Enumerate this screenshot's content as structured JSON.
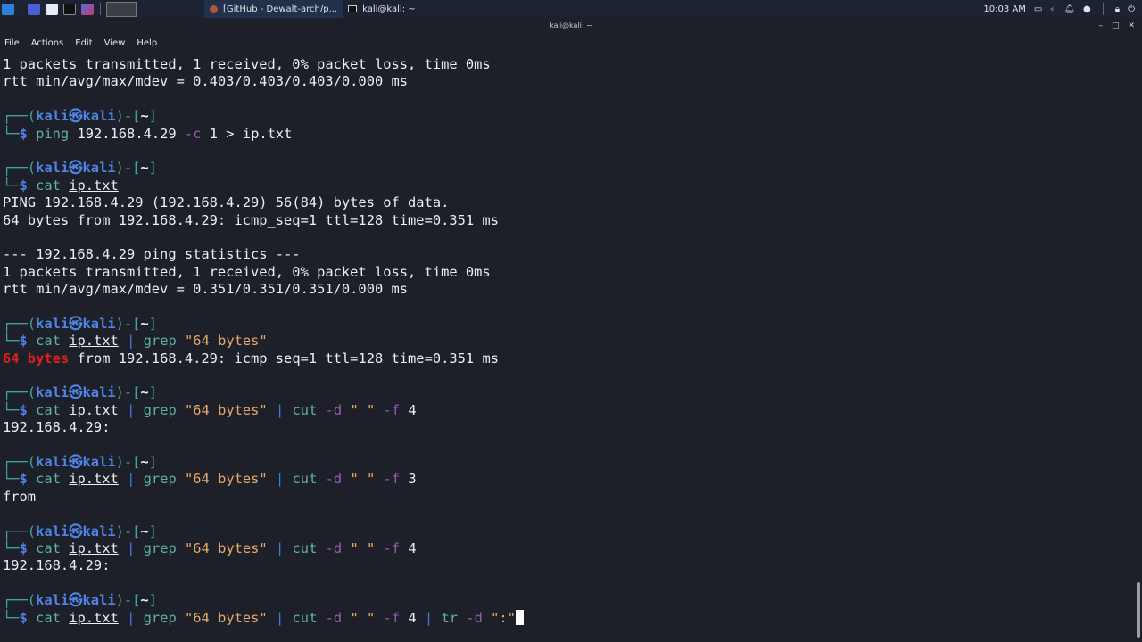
{
  "taskbar": {
    "github_task": "[GitHub - Dewalt-arch/p...",
    "terminal_task": "kali@kali: ~",
    "clock": "10:03 AM"
  },
  "window": {
    "title": "kali@kali: ~"
  },
  "menu": [
    "File",
    "Actions",
    "Edit",
    "View",
    "Help"
  ],
  "colors": {
    "prompt_frame": "#3fa7a1",
    "prompt_user": "#4f84e8",
    "command": "#5fb3a1",
    "string": "#e6a96a",
    "option": "#9b59b6",
    "match": "#e0201e",
    "background": "#1e2029"
  },
  "terminal_lines": [
    [
      [
        "1 packets transmitted, 1 received, 0% packet loss, time 0ms",
        ""
      ]
    ],
    [
      [
        "rtt min/avg/max/mdev = 0.403/0.403/0.403/0.000 ms",
        ""
      ]
    ],
    [],
    "P",
    [
      [
        "└─",
        "f"
      ],
      [
        "$",
        "k"
      ],
      [
        " ",
        ""
      ],
      [
        "ping",
        "c"
      ],
      [
        " 192.168.4.29 ",
        ""
      ],
      [
        "-c",
        "o"
      ],
      [
        " 1 > ip.txt",
        ""
      ]
    ],
    [],
    "P",
    [
      [
        "└─",
        "f"
      ],
      [
        "$",
        "k"
      ],
      [
        " ",
        ""
      ],
      [
        "cat",
        "c"
      ],
      [
        " ",
        ""
      ],
      [
        "ip.txt",
        "u"
      ]
    ],
    [
      [
        "PING 192.168.4.29 (192.168.4.29) 56(84) bytes of data.",
        ""
      ]
    ],
    [
      [
        "64 bytes from 192.168.4.29: icmp_seq=1 ttl=128 time=0.351 ms",
        ""
      ]
    ],
    [],
    [
      [
        "--- 192.168.4.29 ping statistics ---",
        ""
      ]
    ],
    [
      [
        "1 packets transmitted, 1 received, 0% packet loss, time 0ms",
        ""
      ]
    ],
    [
      [
        "rtt min/avg/max/mdev = 0.351/0.351/0.351/0.000 ms",
        ""
      ]
    ],
    [],
    "P",
    [
      [
        "└─",
        "f"
      ],
      [
        "$",
        "k"
      ],
      [
        " ",
        ""
      ],
      [
        "cat",
        "c"
      ],
      [
        " ",
        ""
      ],
      [
        "ip.txt",
        "u"
      ],
      [
        " ",
        ""
      ],
      [
        "|",
        "p"
      ],
      [
        " ",
        ""
      ],
      [
        "grep",
        "c"
      ],
      [
        " ",
        ""
      ],
      [
        "\"64 bytes\"",
        "s"
      ]
    ],
    [
      [
        "64 bytes",
        "r"
      ],
      [
        " from 192.168.4.29: icmp_seq=1 ttl=128 time=0.351 ms",
        ""
      ]
    ],
    [],
    "P",
    [
      [
        "└─",
        "f"
      ],
      [
        "$",
        "k"
      ],
      [
        " ",
        ""
      ],
      [
        "cat",
        "c"
      ],
      [
        " ",
        ""
      ],
      [
        "ip.txt",
        "u"
      ],
      [
        " ",
        ""
      ],
      [
        "|",
        "p"
      ],
      [
        " ",
        ""
      ],
      [
        "grep",
        "c"
      ],
      [
        " ",
        ""
      ],
      [
        "\"64 bytes\"",
        "s"
      ],
      [
        " ",
        ""
      ],
      [
        "|",
        "p"
      ],
      [
        " ",
        ""
      ],
      [
        "cut",
        "c"
      ],
      [
        " ",
        ""
      ],
      [
        "-d",
        "o"
      ],
      [
        " ",
        ""
      ],
      [
        "\" \"",
        "s"
      ],
      [
        " ",
        ""
      ],
      [
        "-f",
        "o"
      ],
      [
        " 4",
        ""
      ]
    ],
    [
      [
        "192.168.4.29:",
        ""
      ]
    ],
    [],
    "P",
    [
      [
        "└─",
        "f"
      ],
      [
        "$",
        "k"
      ],
      [
        " ",
        ""
      ],
      [
        "cat",
        "c"
      ],
      [
        " ",
        ""
      ],
      [
        "ip.txt",
        "u"
      ],
      [
        " ",
        ""
      ],
      [
        "|",
        "p"
      ],
      [
        " ",
        ""
      ],
      [
        "grep",
        "c"
      ],
      [
        " ",
        ""
      ],
      [
        "\"64 bytes\"",
        "s"
      ],
      [
        " ",
        ""
      ],
      [
        "|",
        "p"
      ],
      [
        " ",
        ""
      ],
      [
        "cut",
        "c"
      ],
      [
        " ",
        ""
      ],
      [
        "-d",
        "o"
      ],
      [
        " ",
        ""
      ],
      [
        "\" \"",
        "s"
      ],
      [
        " ",
        ""
      ],
      [
        "-f",
        "o"
      ],
      [
        " 3",
        ""
      ]
    ],
    [
      [
        "from",
        ""
      ]
    ],
    [],
    "P",
    [
      [
        "└─",
        "f"
      ],
      [
        "$",
        "k"
      ],
      [
        " ",
        ""
      ],
      [
        "cat",
        "c"
      ],
      [
        " ",
        ""
      ],
      [
        "ip.txt",
        "u"
      ],
      [
        " ",
        ""
      ],
      [
        "|",
        "p"
      ],
      [
        " ",
        ""
      ],
      [
        "grep",
        "c"
      ],
      [
        " ",
        ""
      ],
      [
        "\"64 bytes\"",
        "s"
      ],
      [
        " ",
        ""
      ],
      [
        "|",
        "p"
      ],
      [
        " ",
        ""
      ],
      [
        "cut",
        "c"
      ],
      [
        " ",
        ""
      ],
      [
        "-d",
        "o"
      ],
      [
        " ",
        ""
      ],
      [
        "\" \"",
        "s"
      ],
      [
        " ",
        ""
      ],
      [
        "-f",
        "o"
      ],
      [
        " 4",
        ""
      ]
    ],
    [
      [
        "192.168.4.29:",
        ""
      ]
    ],
    [],
    "P",
    [
      [
        "└─",
        "f"
      ],
      [
        "$",
        "k"
      ],
      [
        " ",
        ""
      ],
      [
        "cat",
        "c"
      ],
      [
        " ",
        ""
      ],
      [
        "ip.txt",
        "u"
      ],
      [
        " ",
        ""
      ],
      [
        "|",
        "p"
      ],
      [
        " ",
        ""
      ],
      [
        "grep",
        "c"
      ],
      [
        " ",
        ""
      ],
      [
        "\"64 bytes\"",
        "s"
      ],
      [
        " ",
        ""
      ],
      [
        "|",
        "p"
      ],
      [
        " ",
        ""
      ],
      [
        "cut",
        "c"
      ],
      [
        " ",
        ""
      ],
      [
        "-d",
        "o"
      ],
      [
        " ",
        ""
      ],
      [
        "\" \"",
        "s"
      ],
      [
        " ",
        ""
      ],
      [
        "-f",
        "o"
      ],
      [
        " 4 ",
        ""
      ],
      [
        "|",
        "p"
      ],
      [
        " ",
        ""
      ],
      [
        "tr",
        "c"
      ],
      [
        " ",
        ""
      ],
      [
        "-d",
        "o"
      ],
      [
        " ",
        ""
      ],
      [
        "\":\"",
        "s"
      ]
    ]
  ],
  "prompt": [
    [
      "┌──(",
      "f"
    ],
    [
      "kali㉿kali",
      "k"
    ],
    [
      ")-[",
      "f"
    ],
    [
      "~",
      "b"
    ],
    [
      "]",
      "f"
    ]
  ]
}
